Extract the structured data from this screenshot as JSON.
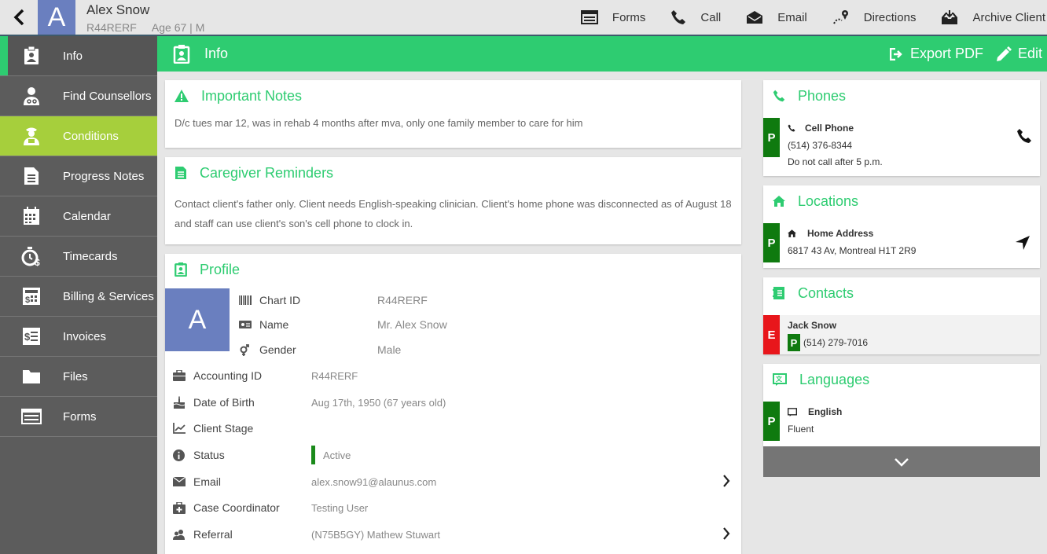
{
  "header": {
    "avatar_letter": "A",
    "name": "Alex Snow",
    "chart_id": "R44RERF",
    "age_sex": "Age 67 | M",
    "actions": [
      {
        "icon": "forms-icon",
        "label": "Forms"
      },
      {
        "icon": "phone-icon",
        "label": "Call"
      },
      {
        "icon": "email-icon",
        "label": "Email"
      },
      {
        "icon": "directions-icon",
        "label": "Directions"
      },
      {
        "icon": "archive-icon",
        "label": "Archive Client"
      }
    ]
  },
  "sidebar": {
    "items": [
      {
        "label": "Info",
        "icon": "clipboard-icon",
        "state": "active"
      },
      {
        "label": "Find Counsellors",
        "icon": "doctor-icon"
      },
      {
        "label": "Conditions",
        "icon": "patient-icon",
        "state": "highlight"
      },
      {
        "label": "Progress Notes",
        "icon": "document-icon"
      },
      {
        "label": "Calendar",
        "icon": "calendar-icon"
      },
      {
        "label": "Timecards",
        "icon": "stopwatch-dollar-icon"
      },
      {
        "label": "Billing & Services",
        "icon": "billing-icon"
      },
      {
        "label": "Invoices",
        "icon": "invoice-icon"
      },
      {
        "label": "Files",
        "icon": "folder-icon"
      },
      {
        "label": "Forms",
        "icon": "list-icon"
      }
    ]
  },
  "section_bar": {
    "title": "Info",
    "export_label": "Export PDF",
    "edit_label": "Edit",
    "color": "#2ecc71"
  },
  "important_notes": {
    "title": "Important Notes",
    "text": "D/c tues mar 12, was in rehab 4 months after mva, only one family member to care for him"
  },
  "caregiver_reminders": {
    "title": "Caregiver Reminders",
    "line1": "Contact client's father only. Client needs English-speaking clinician. Client's home phone was disconnected as of August 18",
    "line2": "and staff can use client's son's cell phone to clock in."
  },
  "profile": {
    "title": "Profile",
    "avatar_letter": "A",
    "chart_id_label": "Chart ID",
    "chart_id": "R44RERF",
    "name_label": "Name",
    "name": "Mr. Alex Snow",
    "gender_label": "Gender",
    "gender": "Male",
    "fields": {
      "accounting_id_label": "Accounting ID",
      "accounting_id": "R44RERF",
      "dob_label": "Date of Birth",
      "dob": "Aug 17th, 1950 (67 years old)",
      "stage_label": "Client Stage",
      "status_label": "Status",
      "status": "Active",
      "email_label": "Email",
      "email": "alex.snow91@alaunus.com",
      "coordinator_label": "Case Coordinator",
      "coordinator": "Testing User",
      "referral_label": "Referral",
      "referral": "(N75B5GY) Mathew Stuwart"
    }
  },
  "phones": {
    "title": "Phones",
    "badge": "P",
    "type": "Cell Phone",
    "number": "(514) 376-8344",
    "note": "Do not call after 5 p.m."
  },
  "locations": {
    "title": "Locations",
    "badge": "P",
    "type": "Home Address",
    "address": "6817 43 Av, Montreal H1T 2R9"
  },
  "contacts": {
    "title": "Contacts",
    "badge": "E",
    "name": "Jack Snow",
    "phone_badge": "P",
    "phone": "(514) 279-7016"
  },
  "languages": {
    "title": "Languages",
    "badge": "P",
    "language": "English",
    "level": "Fluent"
  },
  "colors": {
    "accent_green": "#2ecc71",
    "sidebar_bg": "#5c5c5c",
    "highlight": "#a6cf3c",
    "avatar": "#6a7fbf",
    "badge_green": "#0f7a0f",
    "badge_red": "#e8161b"
  }
}
